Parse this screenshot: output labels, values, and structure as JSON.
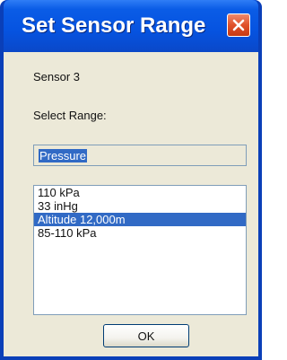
{
  "window": {
    "title": "Set Sensor Range",
    "close_icon": "close-icon"
  },
  "dialog": {
    "sensor_label": "Sensor 3",
    "select_range_label": "Select Range:",
    "selected_value": "Pressure",
    "range_options": [
      "110 kPa",
      "33 inHg",
      "Altitude 12,000m",
      "85-110 kPa"
    ],
    "selected_option": "Altitude 12,000m",
    "ok_label": "OK"
  },
  "colors": {
    "titlebar": "#0653e0",
    "client_background": "#ece9d8",
    "selection": "#316ac5",
    "close_button": "#e0512a"
  }
}
